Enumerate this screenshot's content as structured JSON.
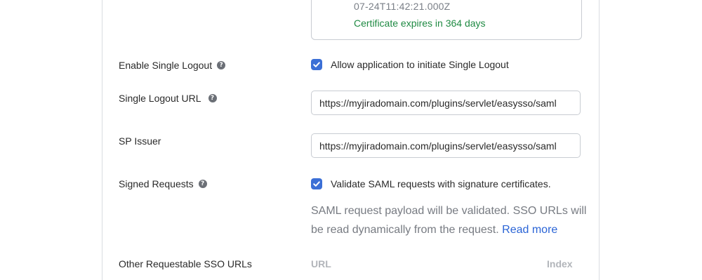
{
  "certificate": {
    "date_text": "07-24T11:42:21.000Z",
    "expiry_text": "Certificate expires in 364 days"
  },
  "single_logout": {
    "label": "Enable Single Logout",
    "checkbox_label": "Allow application to initiate Single Logout",
    "checked": true
  },
  "single_logout_url": {
    "label": "Single Logout URL",
    "value": "https://myjiradomain.com/plugins/servlet/easysso/saml"
  },
  "sp_issuer": {
    "label": "SP Issuer",
    "value": "https://myjiradomain.com/plugins/servlet/easysso/saml"
  },
  "signed_requests": {
    "label": "Signed Requests",
    "checkbox_label": "Validate SAML requests with signature certificates.",
    "checked": true,
    "help_text": "SAML request payload will be validated. SSO URLs will be read dynamically from the request.",
    "read_more": "Read more"
  },
  "other_sso_urls": {
    "label": "Other Requestable SSO URLs",
    "columns": [
      "URL",
      "Index"
    ]
  },
  "icons": {
    "help": "help-circle-icon",
    "check": "checkmark-icon"
  },
  "colors": {
    "accent": "#3b6fd6",
    "success": "#1f8a43",
    "link": "#2a64d6"
  }
}
